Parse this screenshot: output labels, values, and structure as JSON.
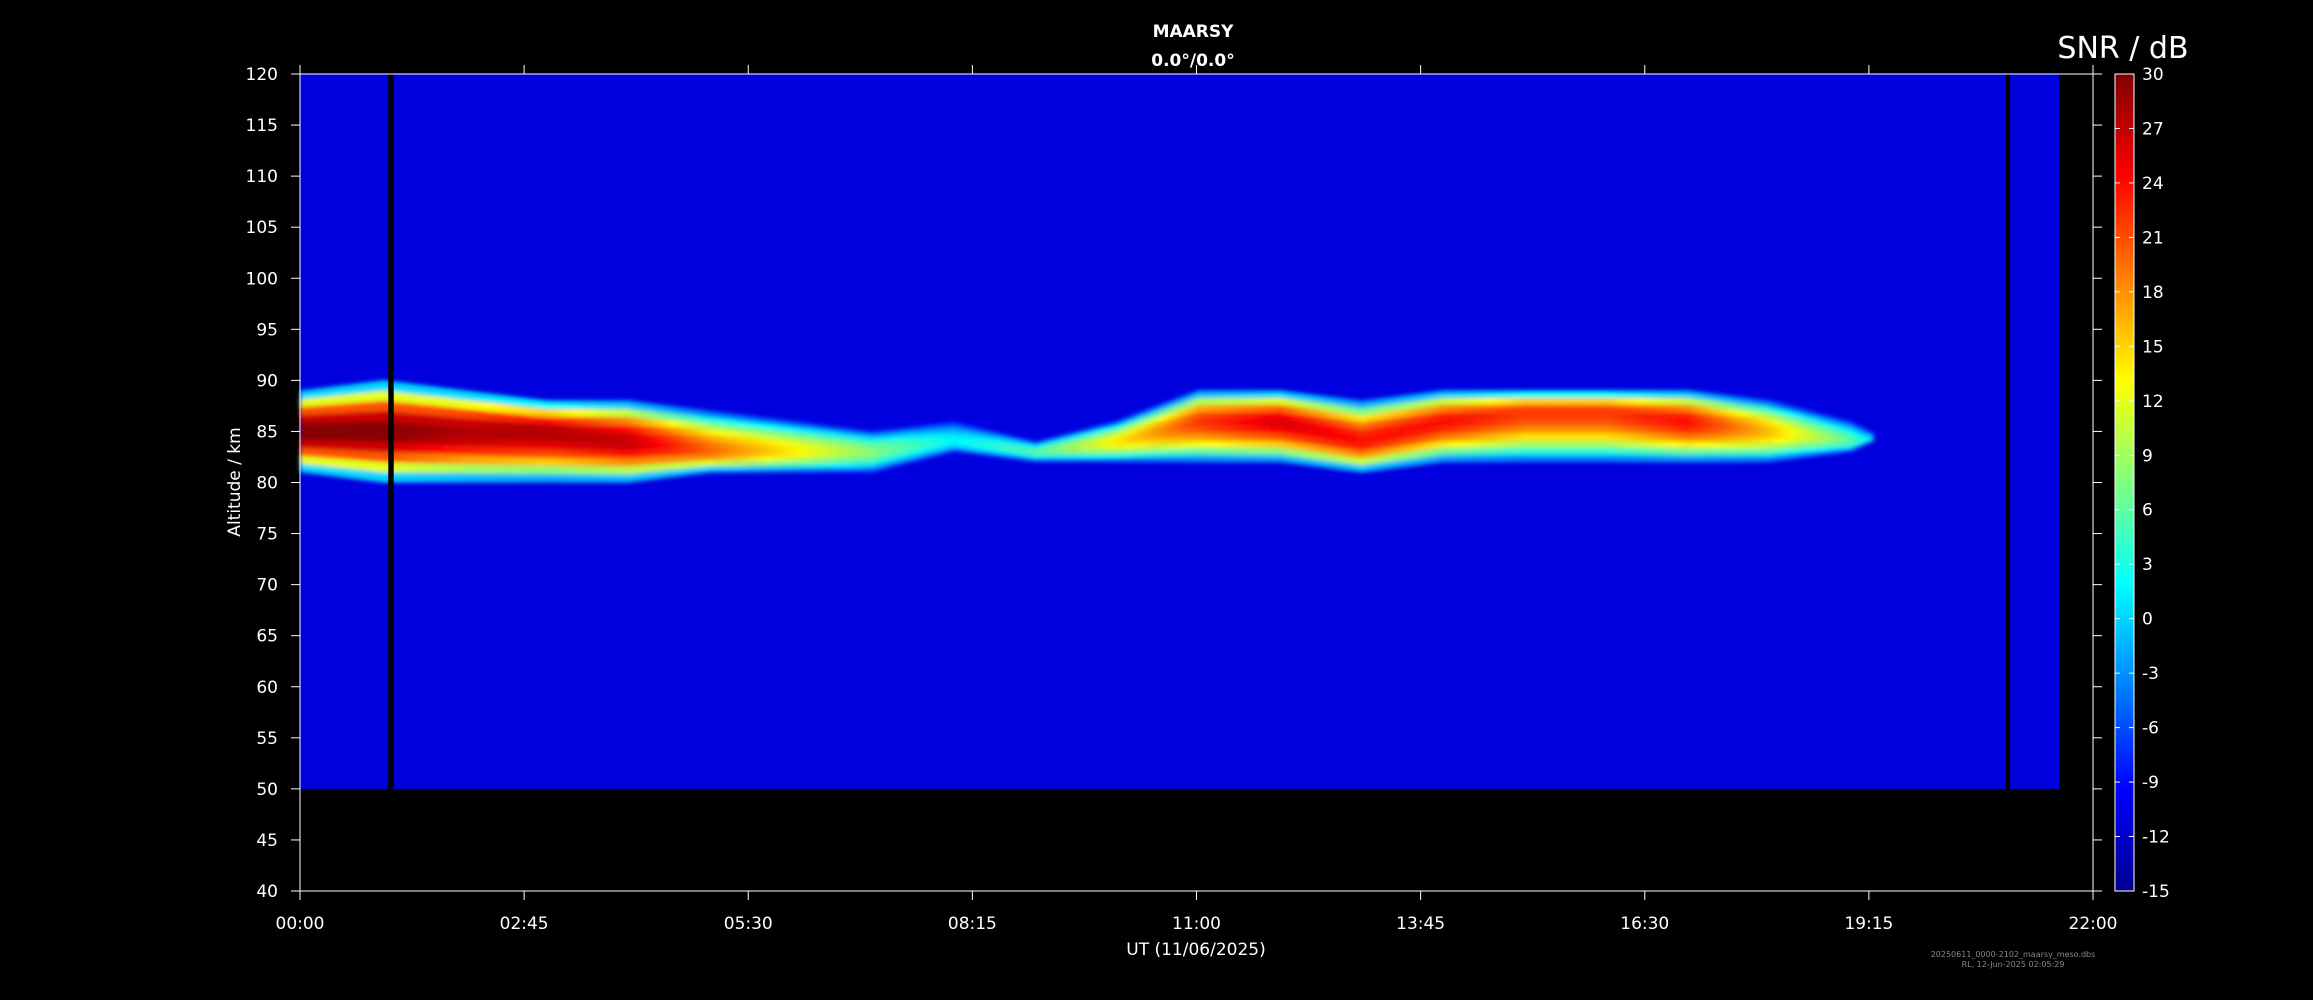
{
  "chart_data": {
    "type": "heatmap",
    "title": "MAARSY",
    "subtitle": "0.0°/0.0°",
    "xlabel": "UT (11/06/2025)",
    "ylabel": "Altitude / km",
    "xlim": [
      "00:00",
      "22:00"
    ],
    "ylim": [
      40,
      120
    ],
    "x_ticks": [
      "00:00",
      "02:45",
      "05:30",
      "08:15",
      "11:00",
      "13:45",
      "16:30",
      "19:15",
      "22:00"
    ],
    "y_ticks": [
      40,
      45,
      50,
      55,
      60,
      65,
      70,
      75,
      80,
      85,
      90,
      95,
      100,
      105,
      110,
      115,
      120
    ],
    "data_altitude_range_km": [
      50,
      120
    ],
    "data_time_range": [
      "00:00",
      "21:35"
    ],
    "background_snr_db": -11,
    "colormap": "jet",
    "colorbar": {
      "label": "SNR / dB",
      "range": [
        -15,
        30
      ],
      "ticks": [
        30,
        27,
        24,
        21,
        18,
        15,
        12,
        9,
        6,
        3,
        0,
        -3,
        -6,
        -9,
        -12,
        -15
      ]
    },
    "data_gaps": [
      {
        "start": "01:05",
        "end": "01:09"
      },
      {
        "start": "20:56",
        "end": "20:59"
      }
    ],
    "echo_layer": {
      "description_points": [
        {
          "t": "00:00",
          "lower_km": 81,
          "upper_km": 89,
          "peak_km": 85,
          "peak_snr_db": 30
        },
        {
          "t": "01:00",
          "lower_km": 80,
          "upper_km": 90,
          "peak_km": 85,
          "peak_snr_db": 30
        },
        {
          "t": "02:00",
          "lower_km": 80,
          "upper_km": 89,
          "peak_km": 85,
          "peak_snr_db": 28
        },
        {
          "t": "03:00",
          "lower_km": 80,
          "upper_km": 88,
          "peak_km": 85,
          "peak_snr_db": 28
        },
        {
          "t": "04:00",
          "lower_km": 80,
          "upper_km": 88,
          "peak_km": 84,
          "peak_snr_db": 27
        },
        {
          "t": "05:00",
          "lower_km": 81,
          "upper_km": 87,
          "peak_km": 83,
          "peak_snr_db": 20
        },
        {
          "t": "06:00",
          "lower_km": 81,
          "upper_km": 86,
          "peak_km": 83,
          "peak_snr_db": 14
        },
        {
          "t": "07:00",
          "lower_km": 81,
          "upper_km": 85,
          "peak_km": 83,
          "peak_snr_db": 8
        },
        {
          "t": "08:00",
          "lower_km": 83,
          "upper_km": 86,
          "peak_km": 84,
          "peak_snr_db": 2
        },
        {
          "t": "09:00",
          "lower_km": 82,
          "upper_km": 84,
          "peak_km": 83,
          "peak_snr_db": 6
        },
        {
          "t": "10:00",
          "lower_km": 82,
          "upper_km": 86,
          "peak_km": 84,
          "peak_snr_db": 14
        },
        {
          "t": "11:00",
          "lower_km": 82,
          "upper_km": 89,
          "peak_km": 86,
          "peak_snr_db": 22
        },
        {
          "t": "12:00",
          "lower_km": 82,
          "upper_km": 89,
          "peak_km": 86,
          "peak_snr_db": 26
        },
        {
          "t": "13:00",
          "lower_km": 81,
          "upper_km": 88,
          "peak_km": 84,
          "peak_snr_db": 24
        },
        {
          "t": "14:00",
          "lower_km": 82,
          "upper_km": 89,
          "peak_km": 86,
          "peak_snr_db": 24
        },
        {
          "t": "15:00",
          "lower_km": 82,
          "upper_km": 89,
          "peak_km": 87,
          "peak_snr_db": 22
        },
        {
          "t": "16:00",
          "lower_km": 82,
          "upper_km": 89,
          "peak_km": 87,
          "peak_snr_db": 22
        },
        {
          "t": "17:00",
          "lower_km": 82,
          "upper_km": 89,
          "peak_km": 86,
          "peak_snr_db": 24
        },
        {
          "t": "18:00",
          "lower_km": 82,
          "upper_km": 88,
          "peak_km": 85,
          "peak_snr_db": 16
        },
        {
          "t": "19:00",
          "lower_km": 83,
          "upper_km": 86,
          "peak_km": 84,
          "peak_snr_db": 6
        },
        {
          "t": "19:15",
          "lower_km": 84,
          "upper_km": 85,
          "peak_km": 84,
          "peak_snr_db": 2
        }
      ]
    },
    "legend_placement": "right",
    "grid": false
  },
  "footer": {
    "line1": "20250611_0000-2102_maarsy_meso.dbs",
    "line2": "RL, 12-Jun-2025 02:05:29"
  }
}
